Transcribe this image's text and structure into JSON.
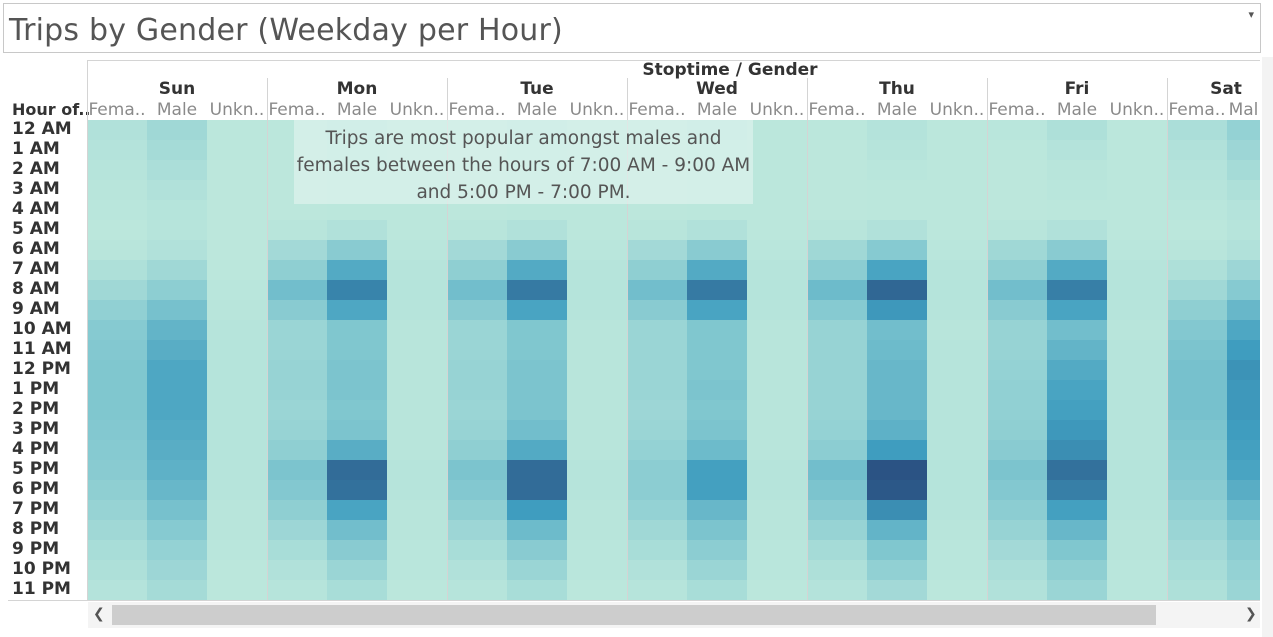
{
  "title": "Trips by Gender (Weekday per Hour)",
  "column_header_title": "Stoptime / Gender",
  "row_header_title": "Hour of..",
  "annotation": "Trips are most popular amongst males and females between the hours of 7:00 AM - 9:00 AM and 5:00 PM - 7:00 PM.",
  "icons": {
    "dropdown": "caret-down-icon",
    "scroll_left": "chevron-left-icon",
    "scroll_right": "chevron-right-icon"
  },
  "colors": {
    "low": "#bfe9dd",
    "high": "#2b5384"
  },
  "chart_data": {
    "type": "heatmap",
    "days": [
      "Sun",
      "Mon",
      "Tue",
      "Wed",
      "Thu",
      "Fri",
      "Sat"
    ],
    "genders": [
      "Fema..",
      "Male",
      "Unkn.."
    ],
    "gender_labels_sat": [
      "Fema..",
      "Mal"
    ],
    "hours": [
      "12 AM",
      "1 AM",
      "2 AM",
      "3 AM",
      "4 AM",
      "5 AM",
      "6 AM",
      "7 AM",
      "8 AM",
      "9 AM",
      "10 AM",
      "11 AM",
      "12 PM",
      "1 PM",
      "2 PM",
      "3 PM",
      "4 PM",
      "5 PM",
      "6 PM",
      "7 PM",
      "8 PM",
      "9 PM",
      "10 PM",
      "11 PM"
    ],
    "intensity_scale": [
      0,
      1
    ],
    "values": {
      "Sun": {
        "female": [
          0.1,
          0.08,
          0.06,
          0.05,
          0.04,
          0.03,
          0.05,
          0.12,
          0.22,
          0.32,
          0.4,
          0.42,
          0.44,
          0.44,
          0.44,
          0.42,
          0.4,
          0.38,
          0.34,
          0.28,
          0.22,
          0.16,
          0.12,
          0.08
        ],
        "male": [
          0.22,
          0.18,
          0.14,
          0.1,
          0.07,
          0.06,
          0.1,
          0.22,
          0.35,
          0.48,
          0.56,
          0.6,
          0.64,
          0.64,
          0.64,
          0.62,
          0.6,
          0.58,
          0.54,
          0.48,
          0.4,
          0.3,
          0.24,
          0.18
        ],
        "unknown": [
          0.03,
          0.03,
          0.02,
          0.02,
          0.02,
          0.02,
          0.02,
          0.03,
          0.04,
          0.05,
          0.06,
          0.07,
          0.07,
          0.07,
          0.07,
          0.07,
          0.07,
          0.06,
          0.06,
          0.05,
          0.05,
          0.04,
          0.03,
          0.03
        ]
      },
      "Mon": {
        "female": [
          0.03,
          0.02,
          0.02,
          0.02,
          0.02,
          0.05,
          0.2,
          0.34,
          0.5,
          0.38,
          0.26,
          0.26,
          0.28,
          0.28,
          0.26,
          0.28,
          0.34,
          0.46,
          0.42,
          0.34,
          0.24,
          0.16,
          0.1,
          0.06
        ],
        "male": [
          0.06,
          0.04,
          0.03,
          0.03,
          0.03,
          0.1,
          0.38,
          0.62,
          0.8,
          0.64,
          0.44,
          0.44,
          0.46,
          0.46,
          0.44,
          0.46,
          0.6,
          0.9,
          0.88,
          0.66,
          0.5,
          0.38,
          0.26,
          0.16
        ],
        "unknown": [
          0.03,
          0.03,
          0.03,
          0.03,
          0.03,
          0.03,
          0.04,
          0.06,
          0.07,
          0.06,
          0.05,
          0.05,
          0.05,
          0.05,
          0.05,
          0.05,
          0.05,
          0.06,
          0.06,
          0.05,
          0.05,
          0.04,
          0.04,
          0.03
        ]
      },
      "Tue": {
        "female": [
          0.03,
          0.02,
          0.02,
          0.02,
          0.02,
          0.05,
          0.2,
          0.34,
          0.5,
          0.38,
          0.26,
          0.26,
          0.28,
          0.28,
          0.26,
          0.28,
          0.34,
          0.46,
          0.42,
          0.34,
          0.24,
          0.16,
          0.1,
          0.06
        ],
        "male": [
          0.06,
          0.04,
          0.03,
          0.03,
          0.03,
          0.1,
          0.38,
          0.62,
          0.84,
          0.66,
          0.44,
          0.44,
          0.46,
          0.46,
          0.46,
          0.5,
          0.62,
          0.9,
          0.9,
          0.7,
          0.52,
          0.38,
          0.26,
          0.16
        ],
        "unknown": [
          0.03,
          0.03,
          0.03,
          0.03,
          0.03,
          0.03,
          0.04,
          0.06,
          0.07,
          0.06,
          0.05,
          0.05,
          0.05,
          0.05,
          0.05,
          0.05,
          0.05,
          0.06,
          0.06,
          0.05,
          0.05,
          0.04,
          0.04,
          0.03
        ]
      },
      "Wed": {
        "female": [
          0.03,
          0.02,
          0.02,
          0.02,
          0.02,
          0.05,
          0.2,
          0.34,
          0.5,
          0.38,
          0.26,
          0.26,
          0.26,
          0.26,
          0.24,
          0.26,
          0.3,
          0.36,
          0.36,
          0.3,
          0.22,
          0.16,
          0.1,
          0.06
        ],
        "male": [
          0.06,
          0.04,
          0.03,
          0.03,
          0.03,
          0.1,
          0.38,
          0.62,
          0.84,
          0.66,
          0.44,
          0.44,
          0.44,
          0.46,
          0.44,
          0.46,
          0.52,
          0.68,
          0.68,
          0.54,
          0.46,
          0.36,
          0.26,
          0.16
        ],
        "unknown": [
          0.03,
          0.03,
          0.03,
          0.03,
          0.03,
          0.03,
          0.04,
          0.06,
          0.07,
          0.06,
          0.05,
          0.05,
          0.05,
          0.05,
          0.05,
          0.05,
          0.05,
          0.06,
          0.06,
          0.05,
          0.05,
          0.04,
          0.04,
          0.03
        ]
      },
      "Thu": {
        "female": [
          0.03,
          0.02,
          0.02,
          0.02,
          0.02,
          0.05,
          0.22,
          0.36,
          0.52,
          0.4,
          0.28,
          0.28,
          0.28,
          0.28,
          0.28,
          0.3,
          0.36,
          0.5,
          0.46,
          0.38,
          0.28,
          0.18,
          0.12,
          0.08
        ],
        "male": [
          0.08,
          0.06,
          0.04,
          0.03,
          0.03,
          0.1,
          0.4,
          0.66,
          0.92,
          0.72,
          0.5,
          0.52,
          0.54,
          0.54,
          0.54,
          0.58,
          0.7,
          1.0,
          0.98,
          0.76,
          0.56,
          0.44,
          0.32,
          0.2
        ],
        "unknown": [
          0.03,
          0.03,
          0.03,
          0.03,
          0.03,
          0.03,
          0.04,
          0.06,
          0.07,
          0.06,
          0.05,
          0.06,
          0.06,
          0.06,
          0.06,
          0.06,
          0.06,
          0.07,
          0.07,
          0.06,
          0.05,
          0.04,
          0.04,
          0.03
        ]
      },
      "Fri": {
        "female": [
          0.04,
          0.03,
          0.02,
          0.02,
          0.02,
          0.05,
          0.22,
          0.34,
          0.5,
          0.38,
          0.28,
          0.28,
          0.3,
          0.32,
          0.32,
          0.34,
          0.38,
          0.46,
          0.42,
          0.36,
          0.28,
          0.2,
          0.14,
          0.1
        ],
        "male": [
          0.12,
          0.08,
          0.05,
          0.04,
          0.03,
          0.1,
          0.38,
          0.62,
          0.82,
          0.66,
          0.5,
          0.56,
          0.62,
          0.66,
          0.68,
          0.72,
          0.76,
          0.88,
          0.82,
          0.68,
          0.54,
          0.44,
          0.34,
          0.26
        ],
        "unknown": [
          0.03,
          0.03,
          0.03,
          0.03,
          0.03,
          0.03,
          0.04,
          0.06,
          0.07,
          0.06,
          0.05,
          0.06,
          0.06,
          0.06,
          0.06,
          0.06,
          0.06,
          0.07,
          0.07,
          0.06,
          0.05,
          0.05,
          0.04,
          0.04
        ]
      },
      "Sat": {
        "female": [
          0.14,
          0.1,
          0.08,
          0.06,
          0.04,
          0.03,
          0.05,
          0.12,
          0.22,
          0.34,
          0.42,
          0.46,
          0.48,
          0.48,
          0.48,
          0.46,
          0.44,
          0.42,
          0.38,
          0.32,
          0.26,
          0.2,
          0.16,
          0.12
        ],
        "male": [
          0.3,
          0.24,
          0.18,
          0.12,
          0.08,
          0.06,
          0.1,
          0.24,
          0.4,
          0.54,
          0.64,
          0.7,
          0.74,
          0.72,
          0.72,
          0.7,
          0.68,
          0.66,
          0.6,
          0.52,
          0.44,
          0.36,
          0.3,
          0.26
        ]
      }
    }
  }
}
